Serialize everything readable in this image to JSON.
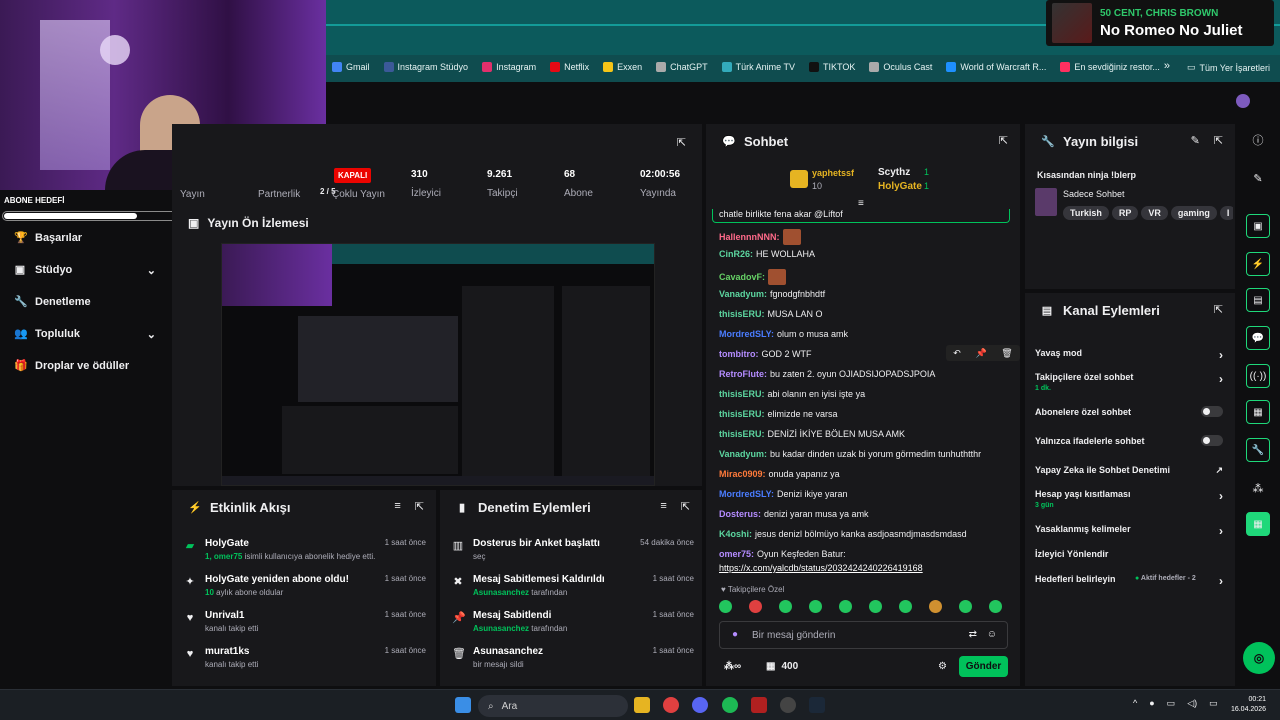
{
  "music": {
    "artist": "50 CENT, CHRIS BROWN",
    "song": "No Romeo No Juliet"
  },
  "bookmarks": [
    "Gmail",
    "Instagram Stüdyo",
    "Instagram",
    "Netflix",
    "Exxen",
    "ChatGPT",
    "Türk Anime TV",
    "TIKTOK",
    "Oculus Cast",
    "World of Warcraft R...",
    "En sevdiğiniz restor..."
  ],
  "bookmarks_all": "Tüm Yer İşaretleri",
  "cam_label": "ABONE HEDEFİ",
  "cam_progress": 0.4,
  "nav": [
    {
      "label": "Başarılar"
    },
    {
      "label": "Stüdyo"
    },
    {
      "label": "Denetleme"
    },
    {
      "label": "Topluluk"
    },
    {
      "label": "Droplar ve ödüller"
    }
  ],
  "stats": {
    "tabs": [
      "Yayın",
      "Partnerlik",
      "Çoklu Yayın"
    ],
    "partner_progress": "2 / 5",
    "status": "KAPALI",
    "viewers": {
      "value": "310",
      "label": "İzleyici"
    },
    "followers": {
      "value": "9.261",
      "label": "Takipçi"
    },
    "subs": {
      "value": "68",
      "label": "Abone"
    },
    "live": {
      "value": "02:00:56",
      "label": "Yayında"
    }
  },
  "preview_title": "Yayın Ön İzlemesi",
  "activity": {
    "title": "Etkinlik Akışı",
    "items": [
      {
        "title": "HolyGate",
        "sub_user": "1, omer75",
        "sub": "isimli kullanıcıya abonelik hediye etti.",
        "time": "1 saat önce"
      },
      {
        "title": "HolyGate yeniden abone oldu!",
        "sub_user": "10",
        "sub": "aylık abone oldular",
        "time": "1 saat önce"
      },
      {
        "title": "Unrival1",
        "sub_user": "",
        "sub": "kanalı takip etti",
        "time": "1 saat önce"
      },
      {
        "title": "murat1ks",
        "sub_user": "",
        "sub": "kanalı takip etti",
        "time": "1 saat önce"
      }
    ]
  },
  "moderation": {
    "title": "Denetim Eylemleri",
    "items": [
      {
        "title": "Dosterus bir Anket başlattı",
        "sub_user": "",
        "sub": "seç",
        "time": "54 dakika önce"
      },
      {
        "title": "Mesaj Sabitlemesi Kaldırıldı",
        "sub_user": "Asunasanchez",
        "sub": "tarafından",
        "time": "1 saat önce"
      },
      {
        "title": "Mesaj Sabitlendi",
        "sub_user": "Asunasanchez",
        "sub": "tarafından",
        "time": "1 saat önce"
      },
      {
        "title": "Asunasanchez",
        "sub_user": "",
        "sub": "bir mesajı sildi",
        "time": "1 saat önce"
      }
    ]
  },
  "chat": {
    "title": "Sohbet",
    "leader1": {
      "name": "yaphetssf",
      "count": "10"
    },
    "leader2": {
      "name": "Scythz",
      "count": "1"
    },
    "leader3": {
      "name": "HolyGate",
      "count": "1"
    },
    "pinned": "chatle birlikte fena akar @Liftof",
    "messages": [
      {
        "user": "HallennnNNN",
        "color": "#ff6a8a",
        "text": ""
      },
      {
        "user": "CinR26",
        "color": "#5cd6a0",
        "text": "HE WOLLAHA"
      },
      {
        "user": "CavadovF",
        "color": "#66d166",
        "text": ""
      },
      {
        "user": "Vanadyum",
        "color": "#5cd6a0",
        "text": "fgnodgfnbhdtf"
      },
      {
        "user": "thisisERU",
        "color": "#5cd6a0",
        "text": "MUSA LAN O"
      },
      {
        "user": "MordredSLY",
        "color": "#4a7cff",
        "text": "olum o musa amk"
      },
      {
        "user": "tombitro",
        "color": "#b48cff",
        "text": "GOD 2 WTF"
      },
      {
        "user": "RetroFlute",
        "color": "#b48cff",
        "text": "bu zaten 2. oyun OJIADSIJOPADSJPOIA"
      },
      {
        "user": "thisisERU",
        "color": "#5cd6a0",
        "text": "abi olanın en iyisi işte ya"
      },
      {
        "user": "thisisERU",
        "color": "#5cd6a0",
        "text": "elimizde ne varsa"
      },
      {
        "user": "thisisERU",
        "color": "#5cd6a0",
        "text": "DENİZİ İKİYE BÖLEN MUSA AMK"
      },
      {
        "user": "Vanadyum",
        "color": "#5cd6a0",
        "text": "bu kadar dinden uzak bi yorum görmedim tunhuthtthr"
      },
      {
        "user": "Mirac0909",
        "color": "#ff7a3a",
        "text": "onuda yapanız ya"
      },
      {
        "user": "MordredSLY",
        "color": "#4a7cff",
        "text": "Denizi ikiye yaran"
      },
      {
        "user": "Dosterus",
        "color": "#b48cff",
        "text": "denizi yaran musa ya amk"
      },
      {
        "user": "K4oshi",
        "color": "#5cd6a0",
        "text": "jesus denizl bölmüyo kanka asdjoasmdjmasdsmdasd"
      },
      {
        "user": "omer75",
        "color": "#b48cff",
        "text": "Oyun Keşfeden Batur:"
      }
    ],
    "link": "https://x.com/yalcdb/status/2032424240226419168",
    "followers_only": "Takipçilere Özel",
    "placeholder": "Bir mesaj gönderin",
    "points": "400",
    "send": "Gönder"
  },
  "info": {
    "title": "Yayın bilgisi",
    "stream_title": "Kısasından ninja !blerp",
    "category": "Sadece Sohbet",
    "tags": [
      "Turkish",
      "RP",
      "VR",
      "gaming",
      "I"
    ]
  },
  "actions": {
    "title": "Kanal Eylemleri",
    "items": [
      {
        "label": "Yavaş mod",
        "sub": "",
        "control": "chevron"
      },
      {
        "label": "Takipçilere özel sohbet",
        "sub": "1 dk.",
        "control": "chevron"
      },
      {
        "label": "Abonelere özel sohbet",
        "sub": "",
        "control": "toggle"
      },
      {
        "label": "Yalnızca ifadelerle sohbet",
        "sub": "",
        "control": "toggle"
      },
      {
        "label": "Yapay Zeka ile Sohbet Denetimi",
        "sub": "",
        "control": "external"
      },
      {
        "label": "Hesap yaşı kısıtlaması",
        "sub": "3 gün",
        "control": "chevron"
      },
      {
        "label": "Yasaklanmış kelimeler",
        "sub": "",
        "control": "chevron"
      },
      {
        "label": "İzleyici Yönlendir",
        "sub": "",
        "control": "none"
      },
      {
        "label": "Hedefleri belirleyin",
        "sub": "",
        "control": "chevron",
        "status": "Aktif hedefler - 2"
      }
    ]
  },
  "taskbar": {
    "search": "Ara",
    "time": "00:21",
    "date": "16.04.2026"
  }
}
